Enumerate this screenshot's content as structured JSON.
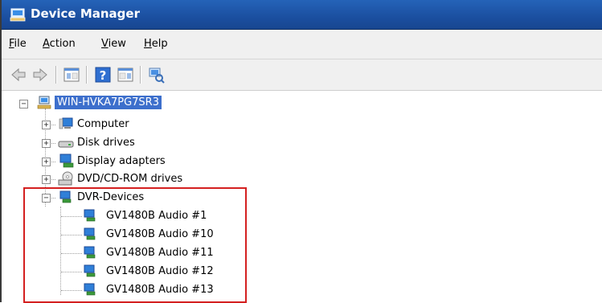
{
  "window": {
    "title": "Device Manager"
  },
  "menu": {
    "file": {
      "mnemonic": "F",
      "rest": "ile"
    },
    "action": {
      "mnemonic": "A",
      "rest": "ction"
    },
    "view": {
      "mnemonic": "V",
      "rest": "iew"
    },
    "help": {
      "mnemonic": "H",
      "rest": "elp"
    }
  },
  "toolbar": {
    "buttons": [
      "back-icon",
      "forward-icon",
      "show-hide-console-tree-icon",
      "help-icon",
      "show-hide-action-pane-icon",
      "scan-hardware-icon"
    ]
  },
  "tree": {
    "root": "WIN-HVKA7PG7SR3",
    "categories": [
      "Computer",
      "Disk drives",
      "Display adapters",
      "DVD/CD-ROM drives",
      "DVR-Devices"
    ],
    "dvr_devices": [
      "GV1480B Audio #1",
      "GV1480B Audio #10",
      "GV1480B Audio #11",
      "GV1480B Audio #12",
      "GV1480B Audio #13"
    ]
  },
  "colors": {
    "title_bar": "#1b4fa0",
    "selection": "#3d6fcc",
    "highlight_border": "#d42020"
  }
}
